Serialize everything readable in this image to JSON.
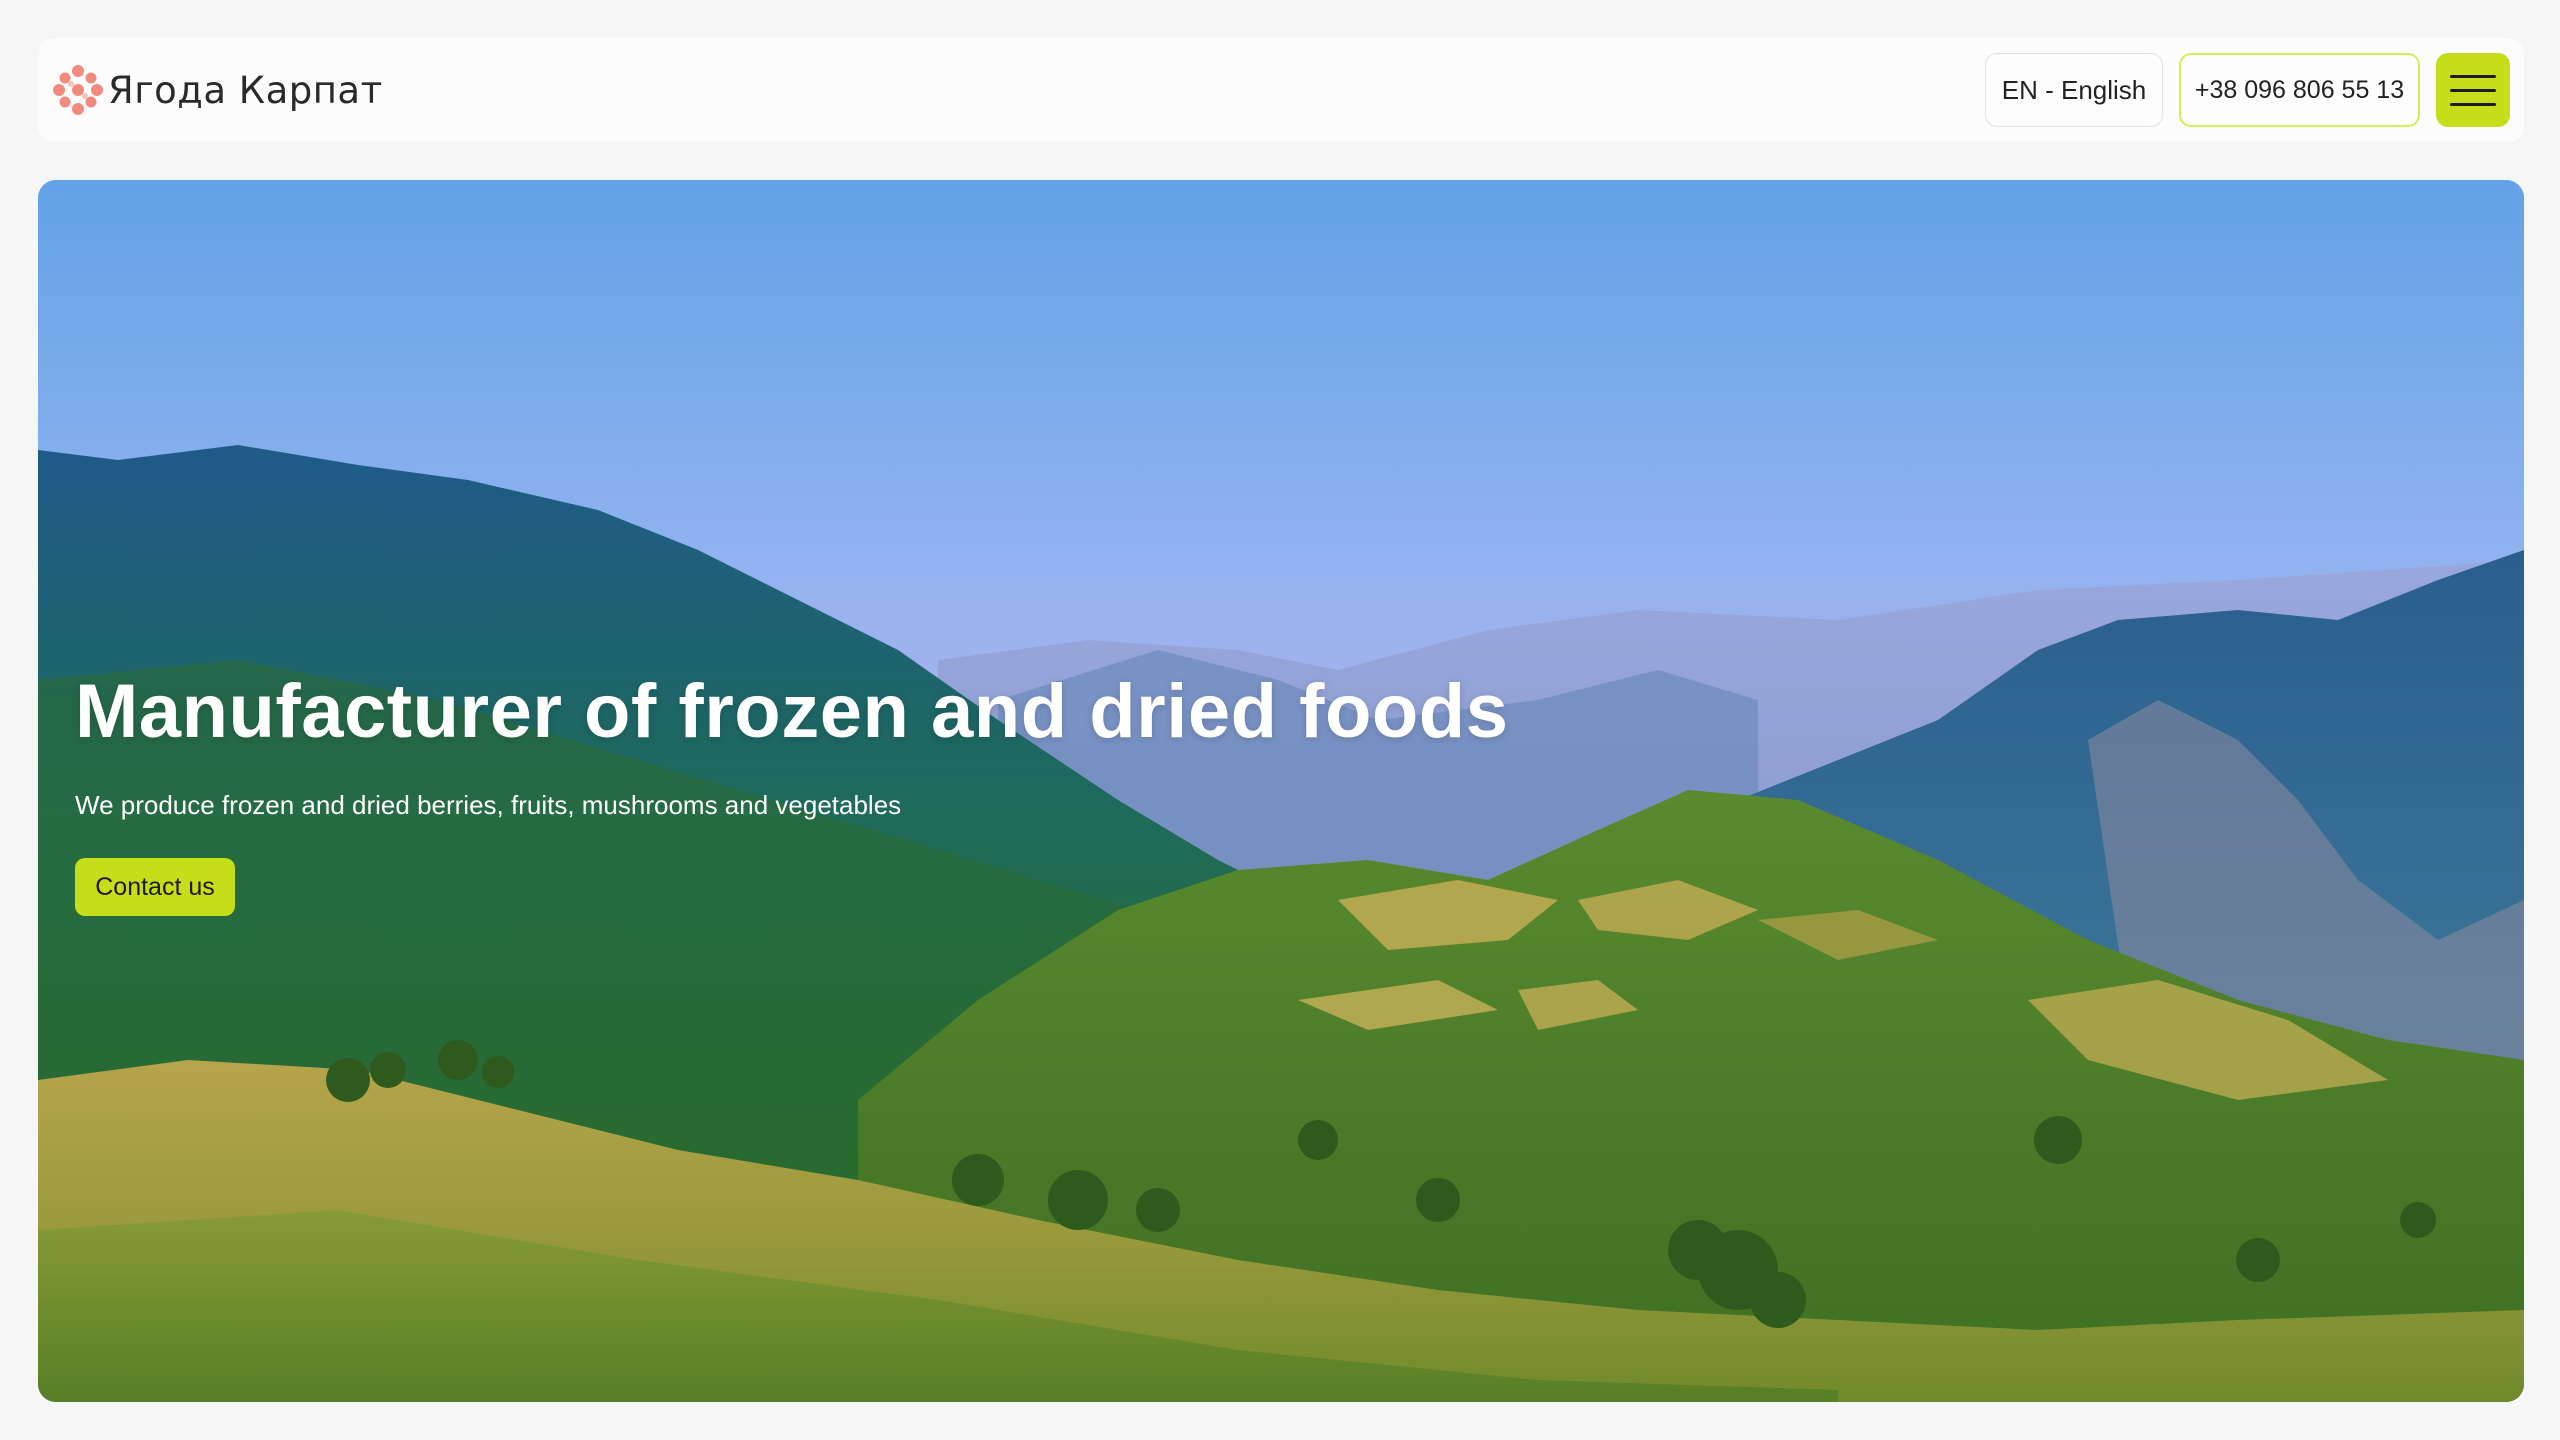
{
  "header": {
    "logo_text": "Ягода Карпат",
    "language_label": "EN - English",
    "phone": "+38 096 806 55 13"
  },
  "hero": {
    "title": "Manufacturer of frozen and dried foods",
    "subtitle": "We produce frozen and dried berries, fruits, mushrooms and vegetables",
    "cta_label": "Contact us"
  },
  "colors": {
    "accent": "#c6dd19",
    "logo_dots": "#f28b7d",
    "page_bg": "#f6f6f6"
  },
  "icons": {
    "logo": "berry-cluster-icon",
    "menu": "hamburger-menu-icon"
  }
}
